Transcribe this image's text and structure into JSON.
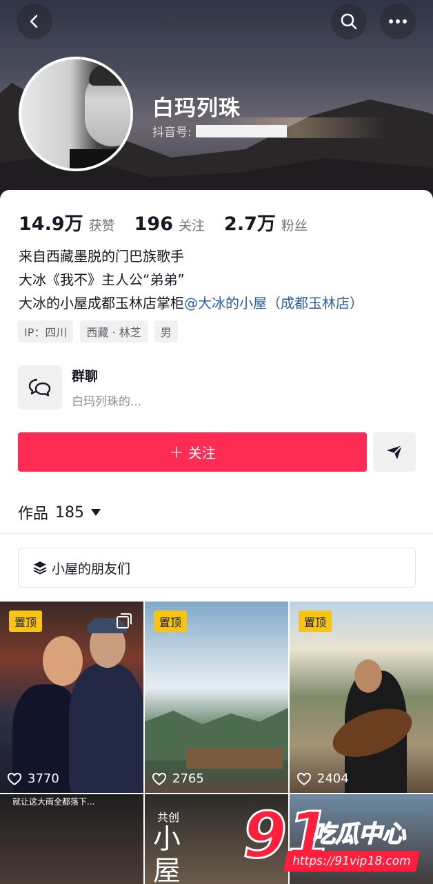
{
  "header": {
    "back_icon": "chevron-left-icon",
    "search_icon": "search-icon",
    "more_icon": "more-horizontal-icon"
  },
  "profile": {
    "name": "白玛列珠",
    "douyin_id_label": "抖音号:"
  },
  "stats": [
    {
      "value": "14.9万",
      "label": "获赞"
    },
    {
      "value": "196",
      "label": "关注"
    },
    {
      "value": "2.7万",
      "label": "粉丝"
    }
  ],
  "bio": {
    "line1": "来自西藏墨脱的门巴族歌手",
    "line2": "大冰《我不》主人公“弟弟”",
    "line3_prefix": "大冰的小屋成都玉林店掌柜",
    "line3_mention": "@大冰的小屋（成都玉林店）"
  },
  "tags": [
    "IP：四川",
    "西藏 · 林芝",
    "男"
  ],
  "group_chat": {
    "title": "群聊",
    "subtitle": "白玛列珠的..."
  },
  "actions": {
    "follow_plus": "+",
    "follow_label": "关注"
  },
  "works": {
    "label": "作品",
    "count": "185"
  },
  "collection": {
    "label": "小屋的朋友们"
  },
  "grid": [
    {
      "pinned": "置顶",
      "likes": "3770"
    },
    {
      "pinned": "置顶",
      "likes": "2765"
    },
    {
      "pinned": "置顶",
      "likes": "2404"
    },
    {
      "caption": "就让这大雨全都落下..."
    },
    {
      "caption": "共创",
      "big_text": "小\n屋\n的"
    },
    {}
  ],
  "watermark": {
    "number": "91",
    "text": "吃瓜中心",
    "url": "https://91vip18.com"
  },
  "colors": {
    "follow_button": "#fe2c55",
    "pin_badge": "#f7c315",
    "mention": "#2a5ea8"
  }
}
